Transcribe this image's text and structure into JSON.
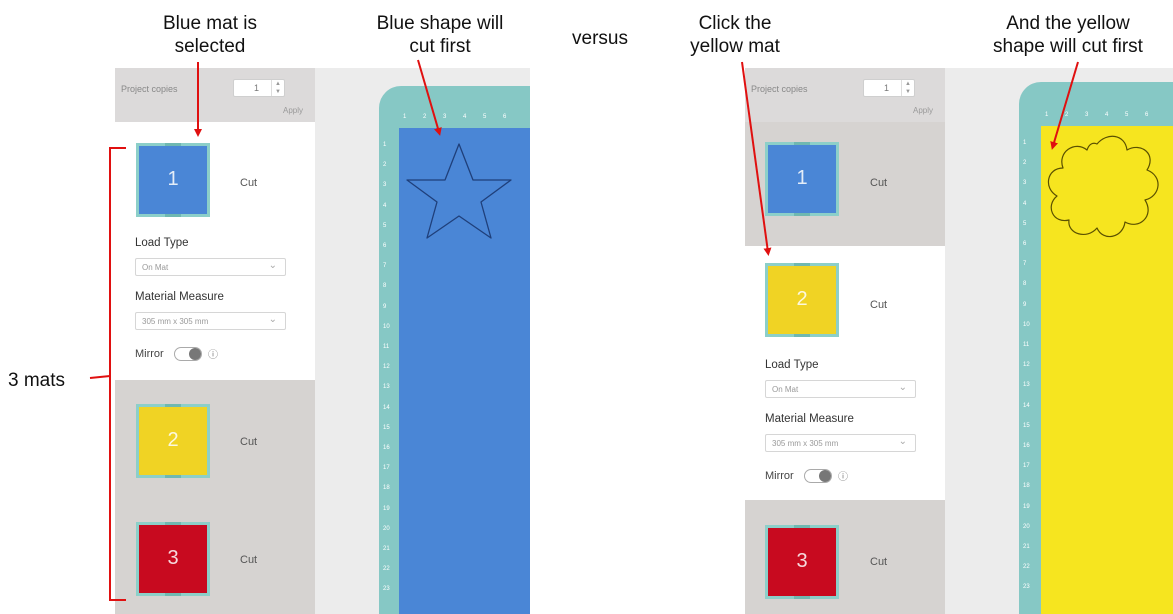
{
  "annotations": {
    "blue_selected_line1": "Blue mat is",
    "blue_selected_line2": "selected",
    "blue_shape_line1": "Blue shape will",
    "blue_shape_line2": "cut first",
    "versus": "versus",
    "click_yellow_line1": "Click the",
    "click_yellow_line2": "yellow mat",
    "yellow_shape_line1": "And the yellow",
    "yellow_shape_line2": "shape will cut first",
    "three_mats": "3 mats"
  },
  "left_panel": {
    "project_copies_label": "Project copies",
    "project_copies_value": "1",
    "apply_label": "Apply",
    "mats": [
      {
        "number": "1",
        "status": "Cut",
        "color": "#4a86d6",
        "selected": true
      },
      {
        "number": "2",
        "status": "Cut",
        "color": "#f0d324",
        "selected": false
      },
      {
        "number": "3",
        "status": "Cut",
        "color": "#c80a1f",
        "selected": false
      }
    ],
    "load_type_label": "Load Type",
    "load_type_value": "On Mat",
    "material_measure_label": "Material Measure",
    "material_measure_value": "305 mm x 305 mm",
    "mirror_label": "Mirror"
  },
  "right_panel": {
    "project_copies_label": "Project copies",
    "project_copies_value": "1",
    "apply_label": "Apply",
    "mats": [
      {
        "number": "1",
        "status": "Cut",
        "color": "#4a86d6",
        "selected": false
      },
      {
        "number": "2",
        "status": "Cut",
        "color": "#f0d324",
        "selected": true
      },
      {
        "number": "3",
        "status": "Cut",
        "color": "#c80a1f",
        "selected": false
      }
    ],
    "load_type_label": "Load Type",
    "load_type_value": "On Mat",
    "material_measure_label": "Material Measure",
    "material_measure_value": "305 mm x 305 mm",
    "mirror_label": "Mirror"
  },
  "left_canvas": {
    "mat_color": "#4a86d6",
    "shape": "star",
    "top_ruler": [
      "1",
      "2",
      "3",
      "4",
      "5",
      "6"
    ],
    "side_ruler": [
      "1",
      "2",
      "3",
      "4",
      "5",
      "6",
      "7",
      "8",
      "9",
      "10",
      "11",
      "12",
      "13",
      "14",
      "15",
      "16",
      "17",
      "18",
      "19",
      "20",
      "21",
      "22",
      "23"
    ]
  },
  "right_canvas": {
    "mat_color": "#f6e51f",
    "shape": "flower",
    "top_ruler": [
      "1",
      "2",
      "3",
      "4",
      "5",
      "6"
    ],
    "side_ruler": [
      "1",
      "2",
      "3",
      "4",
      "5",
      "6",
      "7",
      "8",
      "9",
      "10",
      "11",
      "12",
      "13",
      "14",
      "15",
      "16",
      "17",
      "18",
      "19",
      "20",
      "21",
      "22",
      "23"
    ]
  },
  "colors": {
    "annotation_arrow": "#e01010",
    "mat_border": "#86c8c5"
  }
}
